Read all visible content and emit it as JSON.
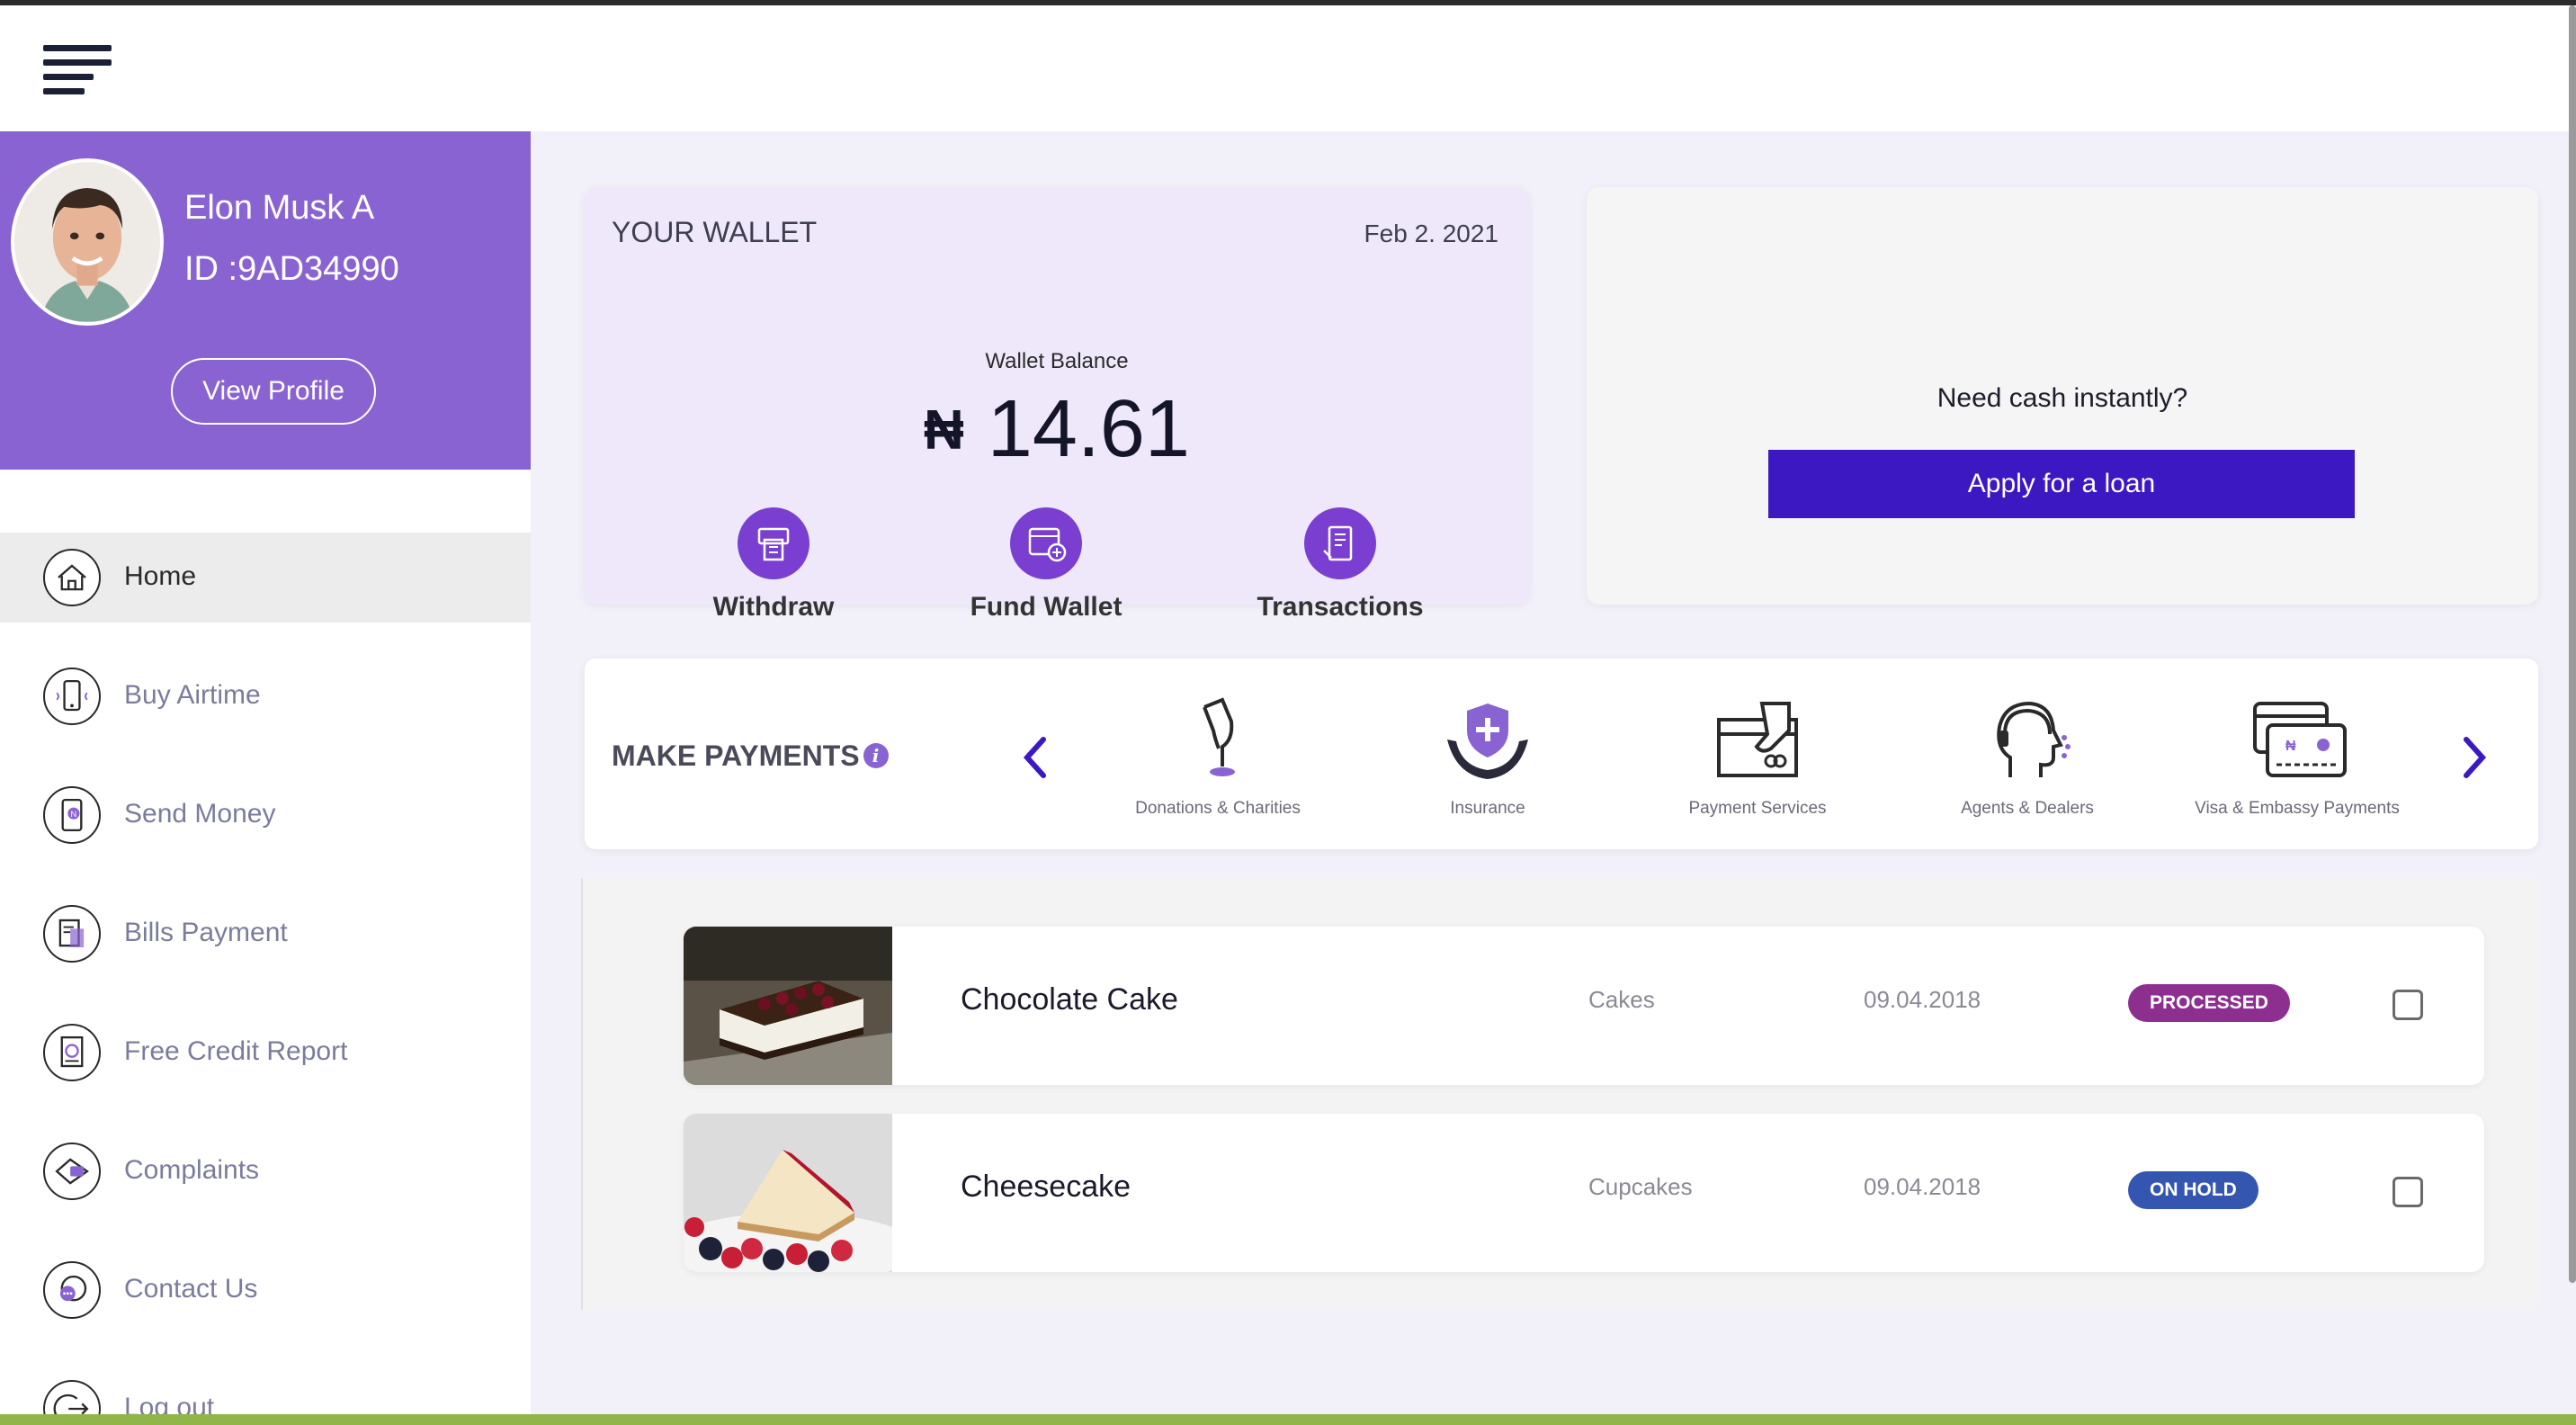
{
  "header": {
    "menu_icon": "hamburger-menu-icon"
  },
  "profile": {
    "name": "Elon Musk A",
    "id": "ID :9AD34990",
    "view_profile_label": "View Profile",
    "brand_color": "#8a63d2"
  },
  "nav": {
    "items": [
      {
        "label": "Home",
        "icon": "home-icon",
        "active": true
      },
      {
        "label": "Buy Airtime",
        "icon": "phone-icon"
      },
      {
        "label": "Send Money",
        "icon": "send-money-icon"
      },
      {
        "label": "Bills Payment",
        "icon": "bill-icon"
      },
      {
        "label": "Free Credit Report",
        "icon": "credit-report-icon"
      },
      {
        "label": "Complaints",
        "icon": "complaints-icon"
      },
      {
        "label": "Contact Us",
        "icon": "chat-icon"
      },
      {
        "label": "Log out",
        "icon": "logout-icon"
      }
    ]
  },
  "wallet": {
    "title": "YOUR WALLET",
    "date": "Feb 2. 2021",
    "balance_label": "Wallet Balance",
    "currency": "₦",
    "balance": "14.61",
    "actions": [
      {
        "label": "Withdraw",
        "icon": "atm-withdraw-icon"
      },
      {
        "label": "Fund Wallet",
        "icon": "fund-wallet-icon"
      },
      {
        "label": "Transactions",
        "icon": "transactions-icon"
      }
    ]
  },
  "loan": {
    "text": "Need cash instantly?",
    "button_label": "Apply for a loan",
    "button_color": "#3c18c2"
  },
  "payments": {
    "title": "MAKE PAYMENTS",
    "info_icon": "info-icon",
    "items": [
      {
        "label": "Donations & Charities",
        "icon": "donation-icon"
      },
      {
        "label": "Insurance",
        "icon": "insurance-icon"
      },
      {
        "label": "Payment Services",
        "icon": "payment-services-icon"
      },
      {
        "label": "Agents & Dealers",
        "icon": "agent-icon"
      },
      {
        "label": "Visa & Embassy Payments",
        "icon": "visa-card-icon"
      }
    ]
  },
  "orders": [
    {
      "name": "Chocolate Cake",
      "category": "Cakes",
      "date": "09.04.2018",
      "status": "PROCESSED",
      "status_color": "#8c2f8f"
    },
    {
      "name": "Cheesecake",
      "category": "Cupcakes",
      "date": "09.04.2018",
      "status": "ON HOLD",
      "status_color": "#3556b0"
    }
  ]
}
